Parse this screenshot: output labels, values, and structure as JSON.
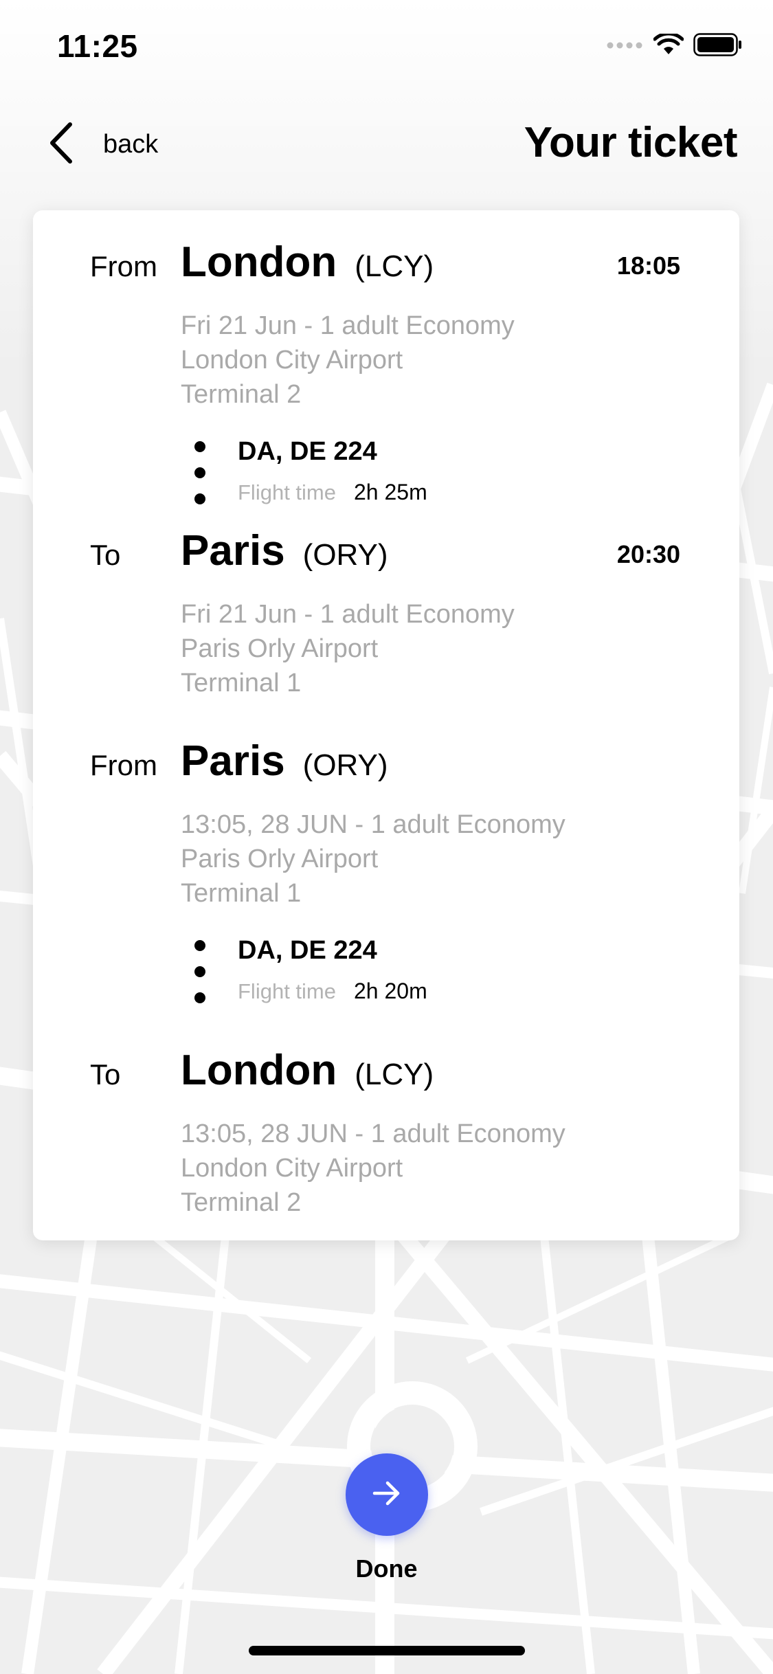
{
  "status_bar": {
    "time": "11:25",
    "icons": [
      "signal-dots-icon",
      "wifi-icon",
      "battery-icon"
    ]
  },
  "header": {
    "back_label": "back",
    "title": "Your ticket",
    "back_icon": "chevron-left-icon"
  },
  "ticket": {
    "segments": [
      {
        "label": "From",
        "city": "London",
        "code": "(LCY)",
        "time": "18:05",
        "details": [
          "Fri 21 Jun - 1 adult Economy",
          "London City Airport",
          "Terminal 2"
        ]
      },
      {
        "label": "To",
        "city": "Paris",
        "code": "(ORY)",
        "time": "20:30",
        "details": [
          "Fri 21 Jun - 1 adult Economy",
          "Paris Orly Airport",
          "Terminal 1"
        ]
      },
      {
        "label": "From",
        "city": "Paris",
        "code": "(ORY)",
        "time": "",
        "details": [
          "13:05, 28 JUN - 1 adult Economy",
          "Paris Orly Airport",
          "Terminal 1"
        ]
      },
      {
        "label": "To",
        "city": "London",
        "code": "(LCY)",
        "time": "",
        "details": [
          "13:05, 28 JUN - 1 adult Economy",
          "London City Airport",
          "Terminal 2"
        ]
      }
    ],
    "flights": [
      {
        "number": "DA, DE 224",
        "time_label": "Flight time",
        "duration": "2h 25m"
      },
      {
        "number": "DA, DE 224",
        "time_label": "Flight time",
        "duration": "2h 20m"
      }
    ]
  },
  "done": {
    "label": "Done",
    "icon": "arrow-right-icon",
    "color": "#4a61f0"
  },
  "colors": {
    "accent": "#4a61f0",
    "muted_text": "#a9a9a9",
    "map_background": "#efefef",
    "map_roads": "#ffffff"
  }
}
